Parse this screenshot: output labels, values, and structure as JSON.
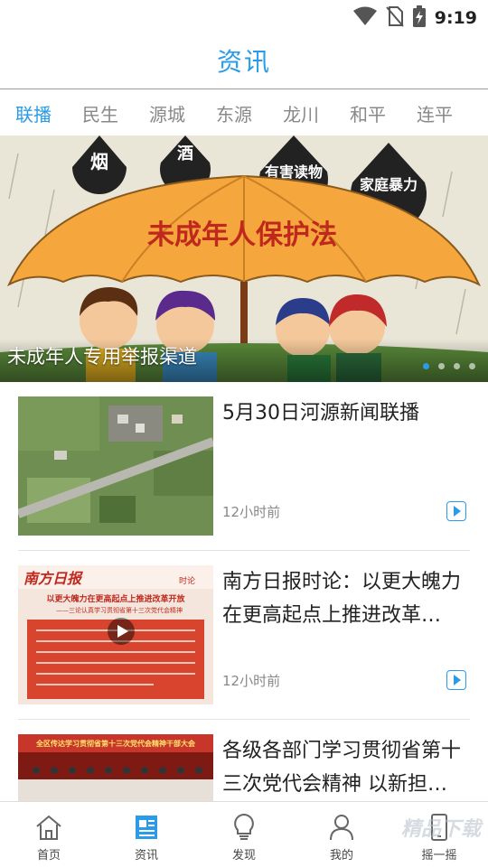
{
  "status_bar": {
    "time": "9:19"
  },
  "header": {
    "title": "资讯"
  },
  "tabs": [
    {
      "label": "联播",
      "active": true
    },
    {
      "label": "民生",
      "active": false
    },
    {
      "label": "源城",
      "active": false
    },
    {
      "label": "东源",
      "active": false
    },
    {
      "label": "龙川",
      "active": false
    },
    {
      "label": "和平",
      "active": false
    },
    {
      "label": "连平",
      "active": false
    }
  ],
  "banner": {
    "caption": "未成年人专用举报渠道",
    "art_text": {
      "umbrella": "未成年人保护法",
      "drop1": "烟",
      "drop2": "酒",
      "drop3": "有害读物",
      "drop4": "家庭暴力"
    },
    "slides": 4,
    "active_slide": 1
  },
  "news": [
    {
      "title": "5月30日河源新闻联播",
      "time": "12小时前",
      "has_video": true
    },
    {
      "title": "南方日报时论：以更大魄力在更高起点上推进改革…",
      "time": "12小时前",
      "has_video": true,
      "thumb_text": {
        "masthead": "南方日报",
        "tag": "时论",
        "headline": "以更大魄力在更高起点上推进改革开放",
        "subline": "——三论认真学习贯彻省第十三次党代会精神"
      }
    },
    {
      "title": "各级各部门学习贯彻省第十三次党代会精神 以新担…",
      "time": "",
      "has_video": false,
      "thumb_text": {
        "banner": "全区传达学习贯彻省第十三次党代会精神干部大会"
      }
    }
  ],
  "bottom_nav": [
    {
      "label": "首页",
      "icon": "home-icon"
    },
    {
      "label": "资讯",
      "icon": "news-icon"
    },
    {
      "label": "发现",
      "icon": "bulb-icon"
    },
    {
      "label": "我的",
      "icon": "person-icon"
    },
    {
      "label": "摇一摇",
      "icon": "phone-shake-icon"
    }
  ],
  "watermark": "精品下载",
  "colors": {
    "accent": "#2a9be8"
  }
}
